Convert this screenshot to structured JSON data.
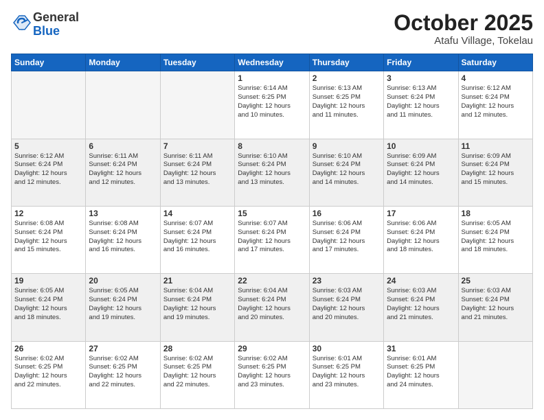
{
  "header": {
    "logo_line1": "General",
    "logo_line2": "Blue",
    "month": "October 2025",
    "location": "Atafu Village, Tokelau"
  },
  "weekdays": [
    "Sunday",
    "Monday",
    "Tuesday",
    "Wednesday",
    "Thursday",
    "Friday",
    "Saturday"
  ],
  "weeks": [
    [
      {
        "day": "",
        "text": "",
        "empty": true
      },
      {
        "day": "",
        "text": "",
        "empty": true
      },
      {
        "day": "",
        "text": "",
        "empty": true
      },
      {
        "day": "1",
        "text": "Sunrise: 6:14 AM\nSunset: 6:25 PM\nDaylight: 12 hours\nand 10 minutes.",
        "empty": false
      },
      {
        "day": "2",
        "text": "Sunrise: 6:13 AM\nSunset: 6:25 PM\nDaylight: 12 hours\nand 11 minutes.",
        "empty": false
      },
      {
        "day": "3",
        "text": "Sunrise: 6:13 AM\nSunset: 6:24 PM\nDaylight: 12 hours\nand 11 minutes.",
        "empty": false
      },
      {
        "day": "4",
        "text": "Sunrise: 6:12 AM\nSunset: 6:24 PM\nDaylight: 12 hours\nand 12 minutes.",
        "empty": false
      }
    ],
    [
      {
        "day": "5",
        "text": "Sunrise: 6:12 AM\nSunset: 6:24 PM\nDaylight: 12 hours\nand 12 minutes.",
        "empty": false
      },
      {
        "day": "6",
        "text": "Sunrise: 6:11 AM\nSunset: 6:24 PM\nDaylight: 12 hours\nand 12 minutes.",
        "empty": false
      },
      {
        "day": "7",
        "text": "Sunrise: 6:11 AM\nSunset: 6:24 PM\nDaylight: 12 hours\nand 13 minutes.",
        "empty": false
      },
      {
        "day": "8",
        "text": "Sunrise: 6:10 AM\nSunset: 6:24 PM\nDaylight: 12 hours\nand 13 minutes.",
        "empty": false
      },
      {
        "day": "9",
        "text": "Sunrise: 6:10 AM\nSunset: 6:24 PM\nDaylight: 12 hours\nand 14 minutes.",
        "empty": false
      },
      {
        "day": "10",
        "text": "Sunrise: 6:09 AM\nSunset: 6:24 PM\nDaylight: 12 hours\nand 14 minutes.",
        "empty": false
      },
      {
        "day": "11",
        "text": "Sunrise: 6:09 AM\nSunset: 6:24 PM\nDaylight: 12 hours\nand 15 minutes.",
        "empty": false
      }
    ],
    [
      {
        "day": "12",
        "text": "Sunrise: 6:08 AM\nSunset: 6:24 PM\nDaylight: 12 hours\nand 15 minutes.",
        "empty": false
      },
      {
        "day": "13",
        "text": "Sunrise: 6:08 AM\nSunset: 6:24 PM\nDaylight: 12 hours\nand 16 minutes.",
        "empty": false
      },
      {
        "day": "14",
        "text": "Sunrise: 6:07 AM\nSunset: 6:24 PM\nDaylight: 12 hours\nand 16 minutes.",
        "empty": false
      },
      {
        "day": "15",
        "text": "Sunrise: 6:07 AM\nSunset: 6:24 PM\nDaylight: 12 hours\nand 17 minutes.",
        "empty": false
      },
      {
        "day": "16",
        "text": "Sunrise: 6:06 AM\nSunset: 6:24 PM\nDaylight: 12 hours\nand 17 minutes.",
        "empty": false
      },
      {
        "day": "17",
        "text": "Sunrise: 6:06 AM\nSunset: 6:24 PM\nDaylight: 12 hours\nand 18 minutes.",
        "empty": false
      },
      {
        "day": "18",
        "text": "Sunrise: 6:05 AM\nSunset: 6:24 PM\nDaylight: 12 hours\nand 18 minutes.",
        "empty": false
      }
    ],
    [
      {
        "day": "19",
        "text": "Sunrise: 6:05 AM\nSunset: 6:24 PM\nDaylight: 12 hours\nand 18 minutes.",
        "empty": false
      },
      {
        "day": "20",
        "text": "Sunrise: 6:05 AM\nSunset: 6:24 PM\nDaylight: 12 hours\nand 19 minutes.",
        "empty": false
      },
      {
        "day": "21",
        "text": "Sunrise: 6:04 AM\nSunset: 6:24 PM\nDaylight: 12 hours\nand 19 minutes.",
        "empty": false
      },
      {
        "day": "22",
        "text": "Sunrise: 6:04 AM\nSunset: 6:24 PM\nDaylight: 12 hours\nand 20 minutes.",
        "empty": false
      },
      {
        "day": "23",
        "text": "Sunrise: 6:03 AM\nSunset: 6:24 PM\nDaylight: 12 hours\nand 20 minutes.",
        "empty": false
      },
      {
        "day": "24",
        "text": "Sunrise: 6:03 AM\nSunset: 6:24 PM\nDaylight: 12 hours\nand 21 minutes.",
        "empty": false
      },
      {
        "day": "25",
        "text": "Sunrise: 6:03 AM\nSunset: 6:24 PM\nDaylight: 12 hours\nand 21 minutes.",
        "empty": false
      }
    ],
    [
      {
        "day": "26",
        "text": "Sunrise: 6:02 AM\nSunset: 6:25 PM\nDaylight: 12 hours\nand 22 minutes.",
        "empty": false
      },
      {
        "day": "27",
        "text": "Sunrise: 6:02 AM\nSunset: 6:25 PM\nDaylight: 12 hours\nand 22 minutes.",
        "empty": false
      },
      {
        "day": "28",
        "text": "Sunrise: 6:02 AM\nSunset: 6:25 PM\nDaylight: 12 hours\nand 22 minutes.",
        "empty": false
      },
      {
        "day": "29",
        "text": "Sunrise: 6:02 AM\nSunset: 6:25 PM\nDaylight: 12 hours\nand 23 minutes.",
        "empty": false
      },
      {
        "day": "30",
        "text": "Sunrise: 6:01 AM\nSunset: 6:25 PM\nDaylight: 12 hours\nand 23 minutes.",
        "empty": false
      },
      {
        "day": "31",
        "text": "Sunrise: 6:01 AM\nSunset: 6:25 PM\nDaylight: 12 hours\nand 24 minutes.",
        "empty": false
      },
      {
        "day": "",
        "text": "",
        "empty": true
      }
    ]
  ]
}
